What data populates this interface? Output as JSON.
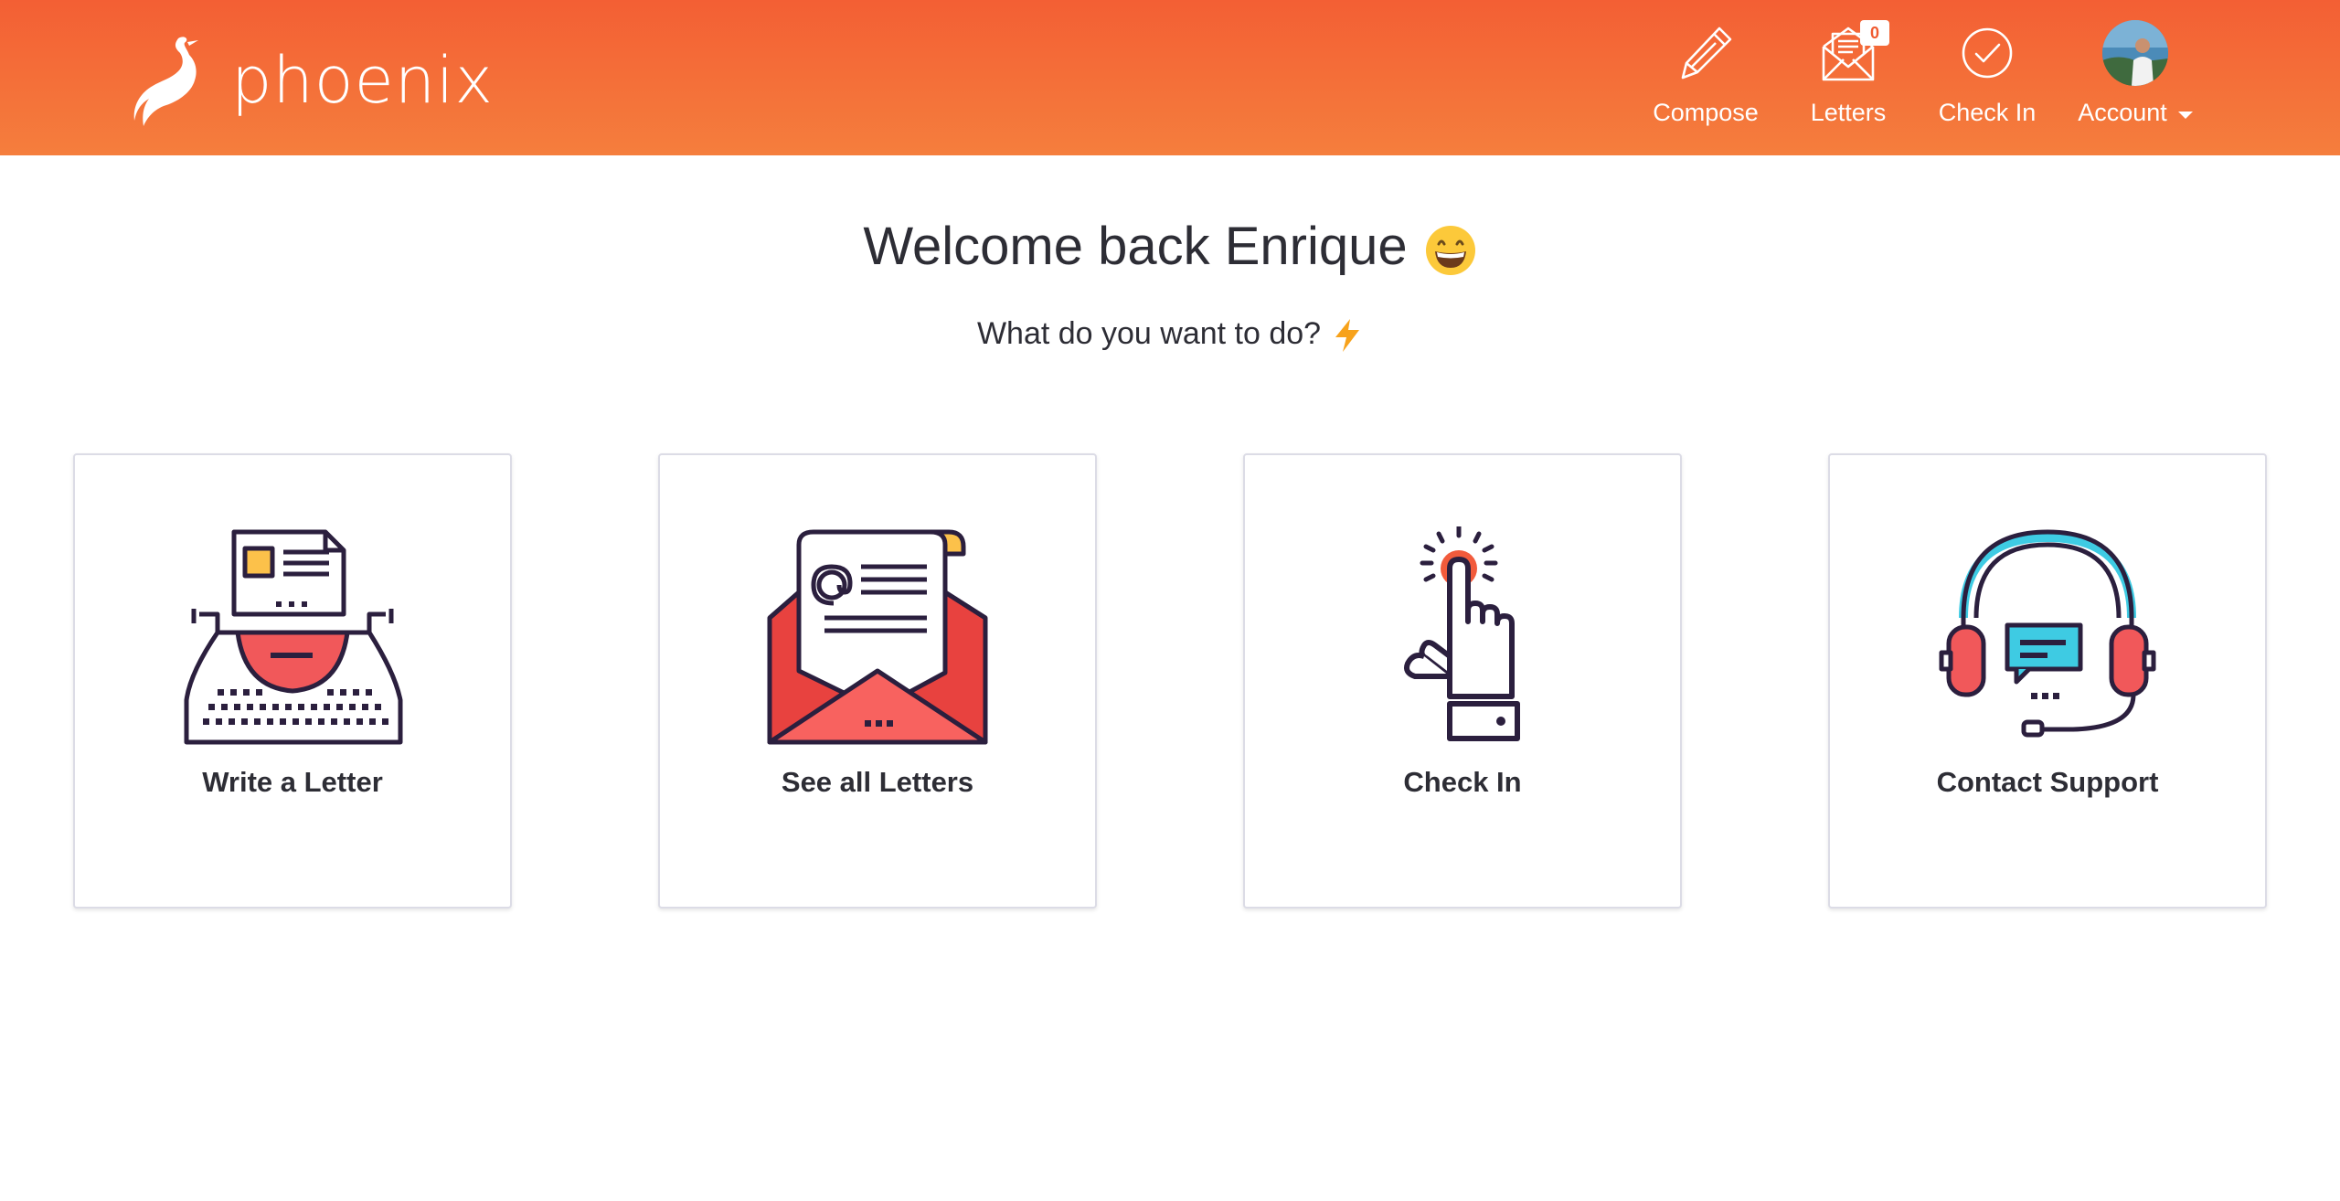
{
  "app": {
    "name": "phoenix"
  },
  "nav": {
    "compose": {
      "label": "Compose",
      "icon": "pencil-icon"
    },
    "letters": {
      "label": "Letters",
      "icon": "envelope-icon",
      "badge": "0"
    },
    "checkin": {
      "label": "Check In",
      "icon": "check-circle-icon"
    },
    "account": {
      "label": "Account",
      "icon": "avatar"
    }
  },
  "welcome": {
    "title": "Welcome back Enrique",
    "title_emoji": "grinning-face-icon",
    "subtitle": "What do you want to do?",
    "subtitle_emoji": "lightning-icon"
  },
  "cards": [
    {
      "label": "Write a Letter",
      "icon": "typewriter-icon"
    },
    {
      "label": "See all Letters",
      "icon": "open-envelope-icon"
    },
    {
      "label": "Check In",
      "icon": "tap-finger-icon"
    },
    {
      "label": "Contact Support",
      "icon": "headset-icon"
    }
  ],
  "colors": {
    "header_top": "#f35f34",
    "header_bottom": "#f57e3d",
    "text": "#2d2d35",
    "card_border": "#dcdce6",
    "accent_red": "#e8423f",
    "accent_yellow": "#fcc14a",
    "accent_cyan": "#3ecbe3"
  }
}
